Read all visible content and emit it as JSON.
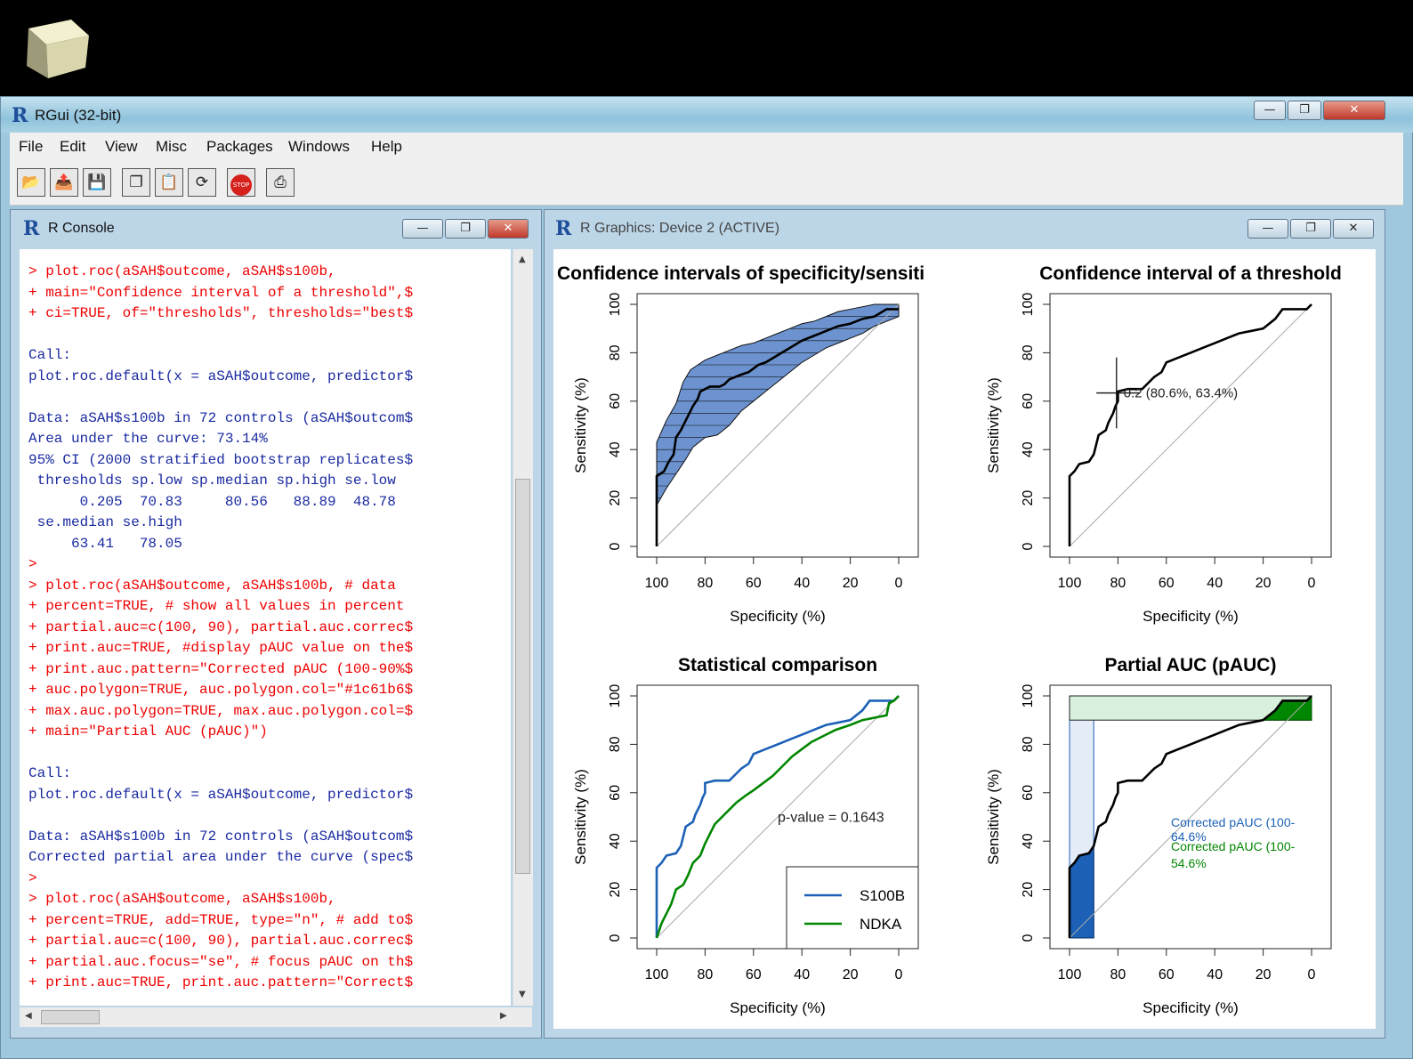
{
  "desktop": {
    "icon": "cube-icon"
  },
  "window": {
    "title": "RGui (32-bit)",
    "icon": "r-logo-icon",
    "controls": [
      "minimize-icon",
      "maximize-icon",
      "close-icon"
    ]
  },
  "menu": [
    "File",
    "Edit",
    "View",
    "Misc",
    "Packages",
    "Windows",
    "Help"
  ],
  "toolbar": [
    "open-script-icon",
    "load-workspace-icon",
    "save-icon",
    "copy-icon",
    "paste-icon",
    "copy-paste-icon",
    "stop-icon",
    "print-icon"
  ],
  "console": {
    "title": "R Console",
    "lines": [
      {
        "t": "in",
        "s": "> plot.roc(aSAH$outcome, aSAH$s100b,"
      },
      {
        "t": "in",
        "s": "+ main=\"Confidence interval of a threshold\",$"
      },
      {
        "t": "in",
        "s": "+ ci=TRUE, of=\"thresholds\", thresholds=\"best$"
      },
      {
        "t": "out",
        "s": ""
      },
      {
        "t": "out",
        "s": "Call:"
      },
      {
        "t": "out",
        "s": "plot.roc.default(x = aSAH$outcome, predictor$"
      },
      {
        "t": "out",
        "s": ""
      },
      {
        "t": "out",
        "s": "Data: aSAH$s100b in 72 controls (aSAH$outcom$"
      },
      {
        "t": "out",
        "s": "Area under the curve: 73.14%"
      },
      {
        "t": "out",
        "s": "95% CI (2000 stratified bootstrap replicates$"
      },
      {
        "t": "out",
        "s": " thresholds sp.low sp.median sp.high se.low"
      },
      {
        "t": "out",
        "s": "      0.205  70.83     80.56   88.89  48.78"
      },
      {
        "t": "out",
        "s": " se.median se.high"
      },
      {
        "t": "out",
        "s": "     63.41   78.05"
      },
      {
        "t": "in",
        "s": ">"
      },
      {
        "t": "in",
        "s": "> plot.roc(aSAH$outcome, aSAH$s100b, # data"
      },
      {
        "t": "in",
        "s": "+ percent=TRUE, # show all values in percent"
      },
      {
        "t": "in",
        "s": "+ partial.auc=c(100, 90), partial.auc.correc$"
      },
      {
        "t": "in",
        "s": "+ print.auc=TRUE, #display pAUC value on the$"
      },
      {
        "t": "in",
        "s": "+ print.auc.pattern=\"Corrected pAUC (100-90%$"
      },
      {
        "t": "in",
        "s": "+ auc.polygon=TRUE, auc.polygon.col=\"#1c61b6$"
      },
      {
        "t": "in",
        "s": "+ max.auc.polygon=TRUE, max.auc.polygon.col=$"
      },
      {
        "t": "in",
        "s": "+ main=\"Partial AUC (pAUC)\")"
      },
      {
        "t": "out",
        "s": ""
      },
      {
        "t": "out",
        "s": "Call:"
      },
      {
        "t": "out",
        "s": "plot.roc.default(x = aSAH$outcome, predictor$"
      },
      {
        "t": "out",
        "s": ""
      },
      {
        "t": "out",
        "s": "Data: aSAH$s100b in 72 controls (aSAH$outcom$"
      },
      {
        "t": "out",
        "s": "Corrected partial area under the curve (spec$"
      },
      {
        "t": "in",
        "s": ">"
      },
      {
        "t": "in",
        "s": "> plot.roc(aSAH$outcome, aSAH$s100b,"
      },
      {
        "t": "in",
        "s": "+ percent=TRUE, add=TRUE, type=\"n\", # add to$"
      },
      {
        "t": "in",
        "s": "+ partial.auc=c(100, 90), partial.auc.correc$"
      },
      {
        "t": "in",
        "s": "+ partial.auc.focus=\"se\", # focus pAUC on th$"
      },
      {
        "t": "in",
        "s": "+ print.auc=TRUE, print.auc.pattern=\"Correct$"
      }
    ]
  },
  "graphics": {
    "title": "R Graphics: Device 2 (ACTIVE)",
    "colors": {
      "blue": "#1c61b6",
      "green": "#008600",
      "band": "#6c93cf"
    }
  },
  "chart_data": [
    {
      "type": "line",
      "title": "Confidence intervals of specificity/sensiti",
      "xlabel": "Specificity (%)",
      "ylabel": "Sensitivity (%)",
      "xlim": [
        100,
        0
      ],
      "ylim": [
        0,
        100
      ],
      "xticks": [
        "100",
        "80",
        "60",
        "40",
        "20",
        "0"
      ],
      "yticks": [
        "0",
        "20",
        "40",
        "60",
        "80",
        "100"
      ],
      "series": [
        {
          "points": [
            [
              100,
              0
            ],
            [
              100,
              29
            ],
            [
              97,
              31
            ],
            [
              95,
              35
            ],
            [
              93,
              38
            ],
            [
              92,
              45
            ],
            [
              90,
              48
            ],
            [
              88,
              52
            ],
            [
              85,
              58
            ],
            [
              83,
              61
            ],
            [
              82,
              64
            ],
            [
              80,
              65
            ],
            [
              78,
              66
            ],
            [
              74,
              66
            ],
            [
              72,
              67
            ],
            [
              70,
              69
            ],
            [
              65,
              71
            ],
            [
              62,
              72
            ],
            [
              58,
              75
            ],
            [
              55,
              76
            ],
            [
              50,
              79
            ],
            [
              45,
              82
            ],
            [
              40,
              85
            ],
            [
              35,
              87
            ],
            [
              30,
              89
            ],
            [
              25,
              91
            ],
            [
              20,
              92
            ],
            [
              15,
              94
            ],
            [
              10,
              95
            ],
            [
              5,
              98
            ],
            [
              0,
              98
            ]
          ]
        }
      ],
      "ci_band": {
        "upper": [
          [
            100,
            43
          ],
          [
            96,
            52
          ],
          [
            92,
            59
          ],
          [
            89,
            68
          ],
          [
            86,
            73
          ],
          [
            83,
            75
          ],
          [
            80,
            77
          ],
          [
            75,
            79
          ],
          [
            70,
            81
          ],
          [
            65,
            83
          ],
          [
            60,
            84
          ],
          [
            55,
            86
          ],
          [
            50,
            88
          ],
          [
            45,
            90
          ],
          [
            40,
            92
          ],
          [
            35,
            93
          ],
          [
            30,
            95
          ],
          [
            25,
            97
          ],
          [
            20,
            98
          ],
          [
            10,
            100
          ],
          [
            0,
            100
          ]
        ],
        "lower": [
          [
            0,
            95
          ],
          [
            5,
            93
          ],
          [
            10,
            91
          ],
          [
            15,
            88
          ],
          [
            20,
            86
          ],
          [
            25,
            84
          ],
          [
            30,
            82
          ],
          [
            35,
            79
          ],
          [
            40,
            76
          ],
          [
            45,
            72
          ],
          [
            50,
            68
          ],
          [
            55,
            64
          ],
          [
            60,
            60
          ],
          [
            65,
            56
          ],
          [
            70,
            50
          ],
          [
            75,
            46
          ],
          [
            80,
            45
          ],
          [
            85,
            41
          ],
          [
            88,
            36
          ],
          [
            92,
            30
          ],
          [
            96,
            24
          ],
          [
            100,
            17
          ]
        ]
      }
    },
    {
      "type": "line",
      "title": "Confidence interval of a threshold",
      "xlabel": "Specificity (%)",
      "ylabel": "Sensitivity (%)",
      "xlim": [
        100,
        0
      ],
      "ylim": [
        0,
        100
      ],
      "xticks": [
        "100",
        "80",
        "60",
        "40",
        "20",
        "0"
      ],
      "yticks": [
        "0",
        "20",
        "40",
        "60",
        "80",
        "100"
      ],
      "series": [
        {
          "points": [
            [
              100,
              0
            ],
            [
              100,
              29
            ],
            [
              98,
              31
            ],
            [
              96,
              34
            ],
            [
              92,
              35
            ],
            [
              90,
              38
            ],
            [
              89,
              42
            ],
            [
              88,
              46
            ],
            [
              85,
              48
            ],
            [
              84,
              51
            ],
            [
              83,
              53
            ],
            [
              82,
              55
            ],
            [
              81,
              58
            ],
            [
              80,
              60
            ],
            [
              80,
              64
            ],
            [
              76,
              65
            ],
            [
              70,
              65
            ],
            [
              68,
              67
            ],
            [
              65,
              70
            ],
            [
              62,
              72
            ],
            [
              60,
              76
            ],
            [
              55,
              78
            ],
            [
              50,
              80
            ],
            [
              45,
              82
            ],
            [
              40,
              84
            ],
            [
              35,
              86
            ],
            [
              30,
              88
            ],
            [
              25,
              89
            ],
            [
              20,
              90
            ],
            [
              15,
              94
            ],
            [
              12,
              98
            ],
            [
              2,
              98
            ],
            [
              0,
              100
            ]
          ]
        }
      ],
      "threshold": {
        "sp": 80.6,
        "se": 63.4,
        "sp_ci": [
          70.83,
          88.89
        ],
        "se_ci": [
          48.78,
          78.05
        ],
        "label": "0.2 (80.6%, 63.4%)"
      }
    },
    {
      "type": "line",
      "title": "Statistical comparison",
      "xlabel": "Specificity (%)",
      "ylabel": "Sensitivity (%)",
      "xlim": [
        100,
        0
      ],
      "ylim": [
        0,
        100
      ],
      "xticks": [
        "100",
        "80",
        "60",
        "40",
        "20",
        "0"
      ],
      "yticks": [
        "0",
        "20",
        "40",
        "60",
        "80",
        "100"
      ],
      "legend": "bottom-right",
      "annotation": "p-value = 0.1643",
      "series": [
        {
          "name": "S100B",
          "color": "#1c61b6",
          "points": [
            [
              100,
              0
            ],
            [
              100,
              29
            ],
            [
              98,
              31
            ],
            [
              96,
              34
            ],
            [
              92,
              35
            ],
            [
              90,
              38
            ],
            [
              89,
              42
            ],
            [
              88,
              46
            ],
            [
              85,
              48
            ],
            [
              84,
              51
            ],
            [
              83,
              53
            ],
            [
              82,
              55
            ],
            [
              81,
              58
            ],
            [
              80,
              60
            ],
            [
              80,
              64
            ],
            [
              76,
              65
            ],
            [
              70,
              65
            ],
            [
              68,
              67
            ],
            [
              65,
              70
            ],
            [
              62,
              72
            ],
            [
              60,
              76
            ],
            [
              55,
              78
            ],
            [
              50,
              80
            ],
            [
              45,
              82
            ],
            [
              40,
              84
            ],
            [
              35,
              86
            ],
            [
              30,
              88
            ],
            [
              25,
              89
            ],
            [
              20,
              90
            ],
            [
              15,
              94
            ],
            [
              12,
              98
            ],
            [
              2,
              98
            ],
            [
              0,
              100
            ]
          ]
        },
        {
          "name": "NDKA",
          "color": "#008600",
          "points": [
            [
              100,
              0
            ],
            [
              99,
              3
            ],
            [
              98,
              6
            ],
            [
              96,
              10
            ],
            [
              94,
              14
            ],
            [
              92,
              20
            ],
            [
              89,
              22
            ],
            [
              87,
              26
            ],
            [
              85,
              31
            ],
            [
              82,
              34
            ],
            [
              80,
              39
            ],
            [
              78,
              43
            ],
            [
              76,
              47
            ],
            [
              73,
              50
            ],
            [
              70,
              53
            ],
            [
              67,
              56
            ],
            [
              63,
              59
            ],
            [
              60,
              61
            ],
            [
              56,
              64
            ],
            [
              52,
              67
            ],
            [
              48,
              71
            ],
            [
              44,
              75
            ],
            [
              40,
              78
            ],
            [
              36,
              81
            ],
            [
              30,
              84
            ],
            [
              26,
              86
            ],
            [
              20,
              88
            ],
            [
              15,
              90
            ],
            [
              10,
              91
            ],
            [
              5,
              92
            ],
            [
              4,
              97
            ],
            [
              2,
              98
            ],
            [
              0,
              100
            ]
          ]
        }
      ]
    },
    {
      "type": "line",
      "title": "Partial AUC (pAUC)",
      "xlabel": "Specificity (%)",
      "ylabel": "Sensitivity (%)",
      "xlim": [
        100,
        0
      ],
      "ylim": [
        0,
        100
      ],
      "xticks": [
        "100",
        "80",
        "60",
        "40",
        "20",
        "0"
      ],
      "yticks": [
        "0",
        "20",
        "40",
        "60",
        "80",
        "100"
      ],
      "series": [
        {
          "points": [
            [
              100,
              0
            ],
            [
              100,
              29
            ],
            [
              98,
              31
            ],
            [
              96,
              34
            ],
            [
              92,
              35
            ],
            [
              90,
              38
            ],
            [
              89,
              42
            ],
            [
              88,
              46
            ],
            [
              85,
              48
            ],
            [
              84,
              51
            ],
            [
              83,
              53
            ],
            [
              82,
              55
            ],
            [
              81,
              58
            ],
            [
              80,
              60
            ],
            [
              80,
              64
            ],
            [
              76,
              65
            ],
            [
              70,
              65
            ],
            [
              68,
              67
            ],
            [
              65,
              70
            ],
            [
              62,
              72
            ],
            [
              60,
              76
            ],
            [
              55,
              78
            ],
            [
              50,
              80
            ],
            [
              45,
              82
            ],
            [
              40,
              84
            ],
            [
              35,
              86
            ],
            [
              30,
              88
            ],
            [
              25,
              89
            ],
            [
              20,
              90
            ],
            [
              15,
              94
            ],
            [
              12,
              98
            ],
            [
              2,
              98
            ],
            [
              0,
              100
            ]
          ]
        }
      ],
      "partial_sp": [
        100,
        90
      ],
      "partial_se": [
        90,
        100
      ],
      "annotations": [
        {
          "text": "Corrected pAUC (100-",
          "color": "#1c61b6"
        },
        {
          "text": "64.6%",
          "color": "#1c61b6"
        },
        {
          "text": "Corrected pAUC (100-",
          "color": "#008600"
        },
        {
          "text": "54.6%",
          "color": "#008600"
        }
      ]
    }
  ]
}
